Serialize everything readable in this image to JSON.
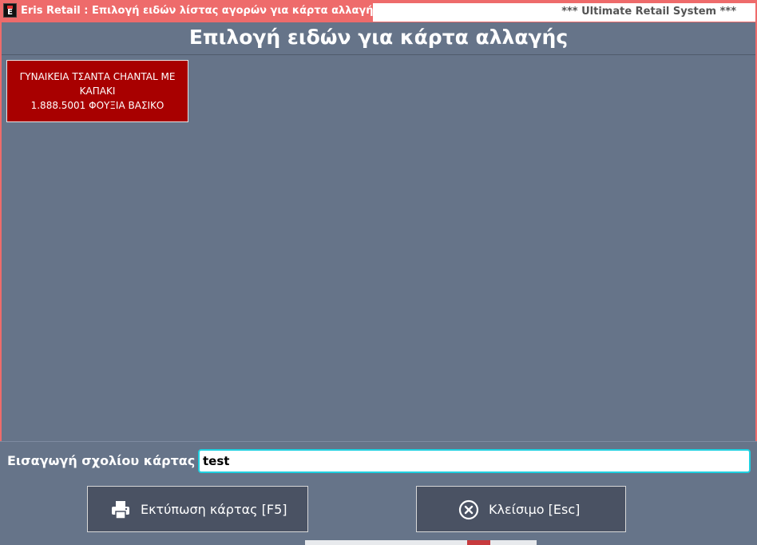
{
  "window": {
    "title": "Eris Retail : Επιλογή ειδών λίστας αγορών για κάρτα αλλαγής",
    "system_name": "*** Ultimate Retail System ***",
    "app_icon_letter": "E"
  },
  "header": {
    "title": "Επιλογή ειδών για κάρτα αλλαγής"
  },
  "items": [
    {
      "line1": "ΓΥΝΑΙΚΕΙΑ ΤΣΑΝΤΑ CHANTAL ΜΕ",
      "line2": "ΚΑΠΑΚΙ",
      "line3": "1.888.5001  ΦΟΥΞΙΑ  ΒΑΣΙΚΟ"
    }
  ],
  "comment": {
    "label": "Εισαγωγή σχολίου κάρτας",
    "value": "test"
  },
  "buttons": {
    "print_label": "Εκτύπωση κάρτας [F5]",
    "close_label": "Κλείσιμο [Esc]"
  },
  "icons": {
    "app": "eris-app-icon",
    "print": "printer-icon",
    "close": "close-circle-icon"
  },
  "colors": {
    "titlebar": "#ee6b6b",
    "background": "#667489",
    "item_tile": "#a80000",
    "button": "#4a5263",
    "input_border": "#1fd0e0"
  }
}
